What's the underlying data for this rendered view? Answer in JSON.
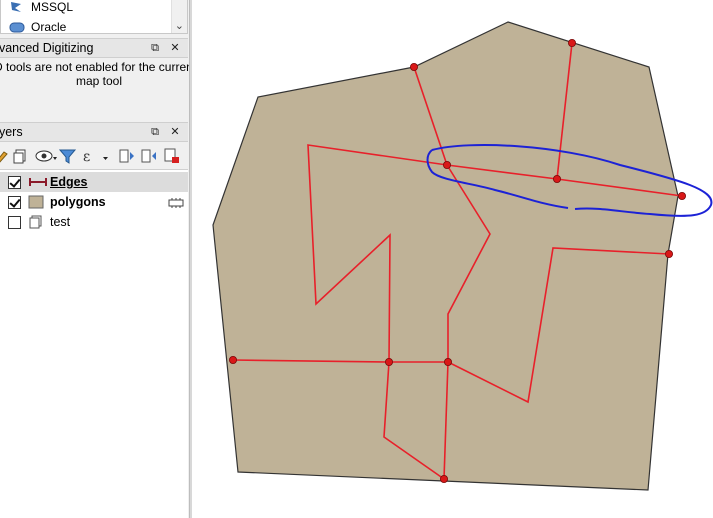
{
  "browser": {
    "items": [
      {
        "label": "MSSQL",
        "icon": "mssql-icon"
      },
      {
        "label": "Oracle",
        "icon": "oracle-icon"
      }
    ]
  },
  "advanced_digitizing": {
    "title": "dvanced Digitizing",
    "message_line1": "D tools are not enabled for the current",
    "message_line2": "map tool"
  },
  "layers_panel": {
    "title": "ayers",
    "layers": [
      {
        "label": "Edges",
        "checked": true,
        "type": "line",
        "bold": true,
        "underline": true,
        "selected": true
      },
      {
        "label": "polygons",
        "checked": true,
        "type": "polygon",
        "bold": true,
        "editing": true
      },
      {
        "label": "test",
        "checked": false,
        "type": "group"
      }
    ]
  },
  "colors": {
    "polygon_fill": "#bfb297",
    "polygon_stroke": "#333333",
    "edge_line": "#e8202a",
    "vertex": "#d91818",
    "annotation": "#1c22d6"
  }
}
